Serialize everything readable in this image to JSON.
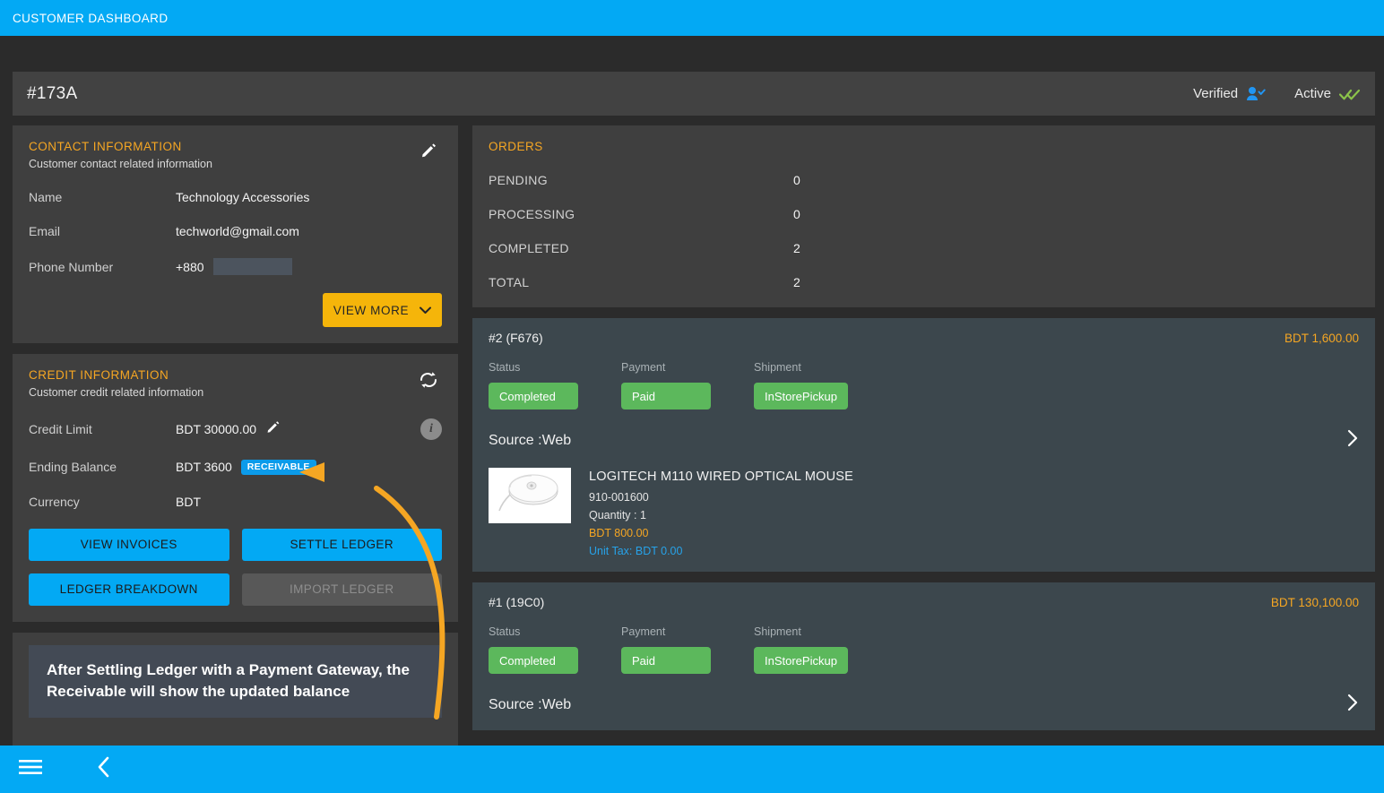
{
  "topbar": {
    "title": "CUSTOMER DASHBOARD"
  },
  "customer": {
    "id": "#173A",
    "verified_label": "Verified",
    "active_label": "Active"
  },
  "contact": {
    "title": "CONTACT INFORMATION",
    "subtitle": "Customer contact related information",
    "edit_icon": "pencil-icon",
    "rows": [
      {
        "key": "Name",
        "value": "Technology Accessories"
      },
      {
        "key": "Email",
        "value": "techworld@gmail.com"
      },
      {
        "key": "Phone Number",
        "value": "+880",
        "redacted": true
      }
    ],
    "view_more_label": "VIEW MORE"
  },
  "credit": {
    "title": "CREDIT INFORMATION",
    "subtitle": "Customer credit related information",
    "refresh_icon": "sync-icon",
    "info_icon": "info-icon",
    "credit_limit_key": "Credit Limit",
    "credit_limit_value": "BDT 30000.00",
    "ending_balance_key": "Ending Balance",
    "ending_balance_value": "BDT 3600",
    "ending_balance_badge": "RECEIVABLE",
    "currency_key": "Currency",
    "currency_value": "BDT",
    "buttons": [
      {
        "label": "VIEW INVOICES",
        "state": "enabled"
      },
      {
        "label": "SETTLE LEDGER",
        "state": "enabled"
      },
      {
        "label": "LEDGER BREAKDOWN",
        "state": "enabled"
      },
      {
        "label": "IMPORT LEDGER",
        "state": "disabled"
      }
    ]
  },
  "callout": {
    "text": "After Settling Ledger with a Payment Gateway, the Receivable will show the updated balance"
  },
  "orders": {
    "title": "ORDERS",
    "summary": [
      {
        "label": "PENDING",
        "value": "0"
      },
      {
        "label": "PROCESSING",
        "value": "0"
      },
      {
        "label": "COMPLETED",
        "value": "2"
      },
      {
        "label": "TOTAL",
        "value": "2"
      }
    ],
    "col_labels": {
      "status": "Status",
      "payment": "Payment",
      "shipment": "Shipment"
    },
    "source_prefix": "Source : ",
    "cards": [
      {
        "number": "#2 (F676)",
        "amount": "BDT 1,600.00",
        "status": "Completed",
        "payment": "Paid",
        "shipment": "InStorePickup",
        "source": "Web",
        "items": [
          {
            "name": "LOGITECH M110 WIRED OPTICAL MOUSE",
            "sku": "910-001600",
            "quantity": "Quantity : 1",
            "price": "BDT 800.00",
            "tax": "Unit Tax: BDT 0.00",
            "thumb": "computer-mouse-image"
          }
        ]
      },
      {
        "number": "#1 (19C0)",
        "amount": "BDT 130,100.00",
        "status": "Completed",
        "payment": "Paid",
        "shipment": "InStorePickup",
        "source": "Web",
        "items": []
      }
    ]
  },
  "bottombar": {
    "menu_icon": "hamburger-menu-icon",
    "back_icon": "chevron-left-icon"
  },
  "colors": {
    "accent_blue": "#03a9f4",
    "accent_orange": "#f5a623",
    "status_green": "#5cb85c",
    "annotation_orange": "#f5a623",
    "panel": "#3f3f3f",
    "order_card": "#3c474d",
    "page_bg": "#2b2b2b"
  }
}
